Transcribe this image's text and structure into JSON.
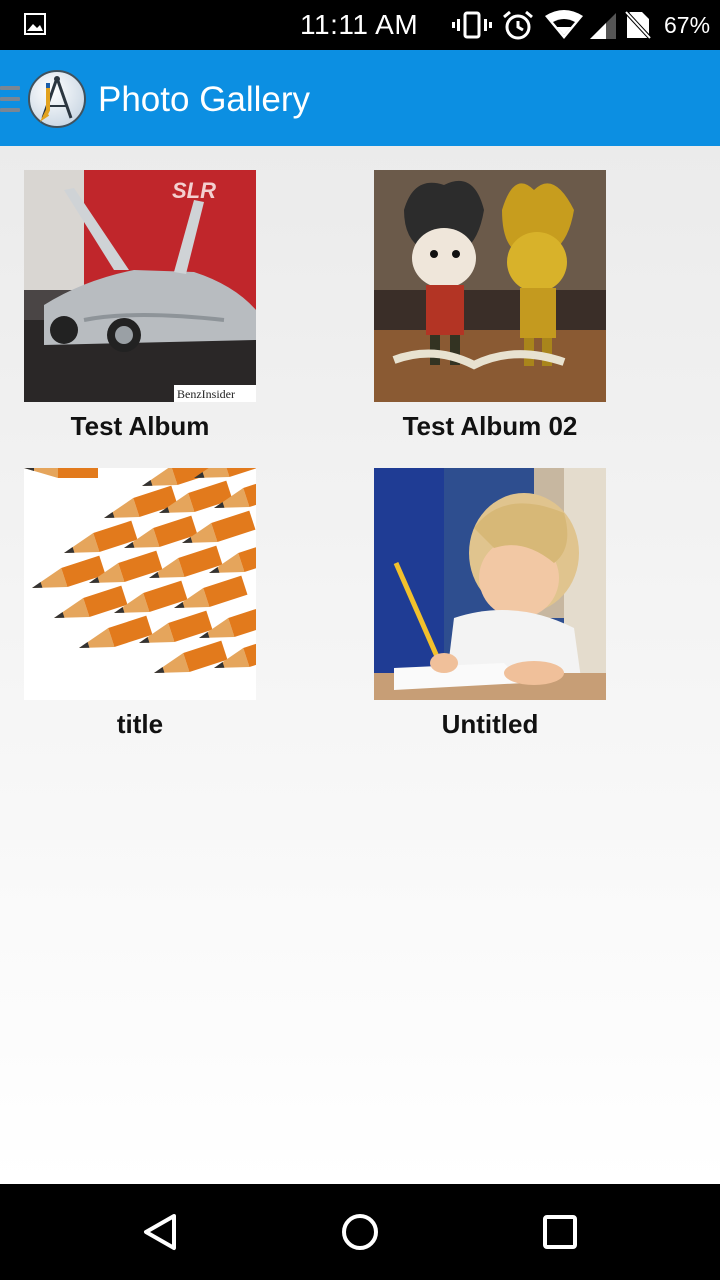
{
  "status_bar": {
    "time": "11:11 AM",
    "battery": "67%",
    "icons": [
      "gallery-notification-icon",
      "vibrate-icon",
      "alarm-icon",
      "wifi-icon",
      "signal-icon",
      "no-sim-icon"
    ]
  },
  "app_bar": {
    "title": "Photo Gallery",
    "logo": "drafting-compass-logo",
    "color": "#0c8fe2"
  },
  "albums": [
    {
      "title": "Test Album",
      "image": "silver sports car"
    },
    {
      "title": "Test Album 02",
      "image": "two cartoon figurines"
    },
    {
      "title": "title",
      "image": "stacked pencils"
    },
    {
      "title": "Untitled",
      "image": "child writing with pencil"
    }
  ],
  "thumbnail_watermark": "BenzInsider",
  "nav_bar": {
    "icons": [
      "back-icon",
      "home-icon",
      "recents-icon"
    ]
  }
}
